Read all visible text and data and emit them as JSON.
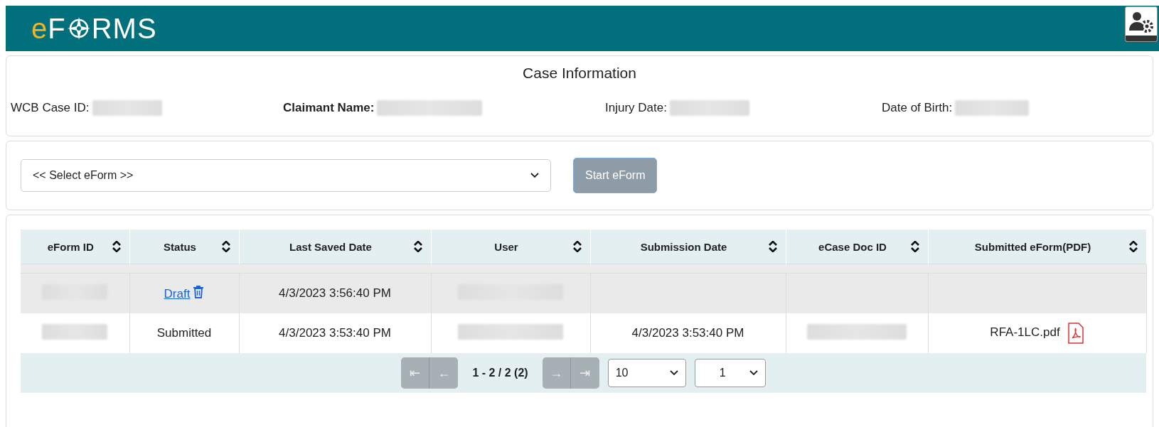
{
  "header": {
    "logo_prefix": "e",
    "logo_rest_1": "F",
    "logo_rest_2": "RMS"
  },
  "case_information": {
    "title": "Case Information",
    "fields": [
      {
        "label": "WCB Case ID:",
        "bold": false
      },
      {
        "label": "Claimant Name:",
        "bold": true
      },
      {
        "label": "Injury Date:",
        "bold": false
      },
      {
        "label": "Date of Birth:",
        "bold": false
      }
    ]
  },
  "eform_picker": {
    "select": {
      "value": "<< Select eForm >>"
    },
    "start_button": {
      "label": "Start eForm",
      "disabled": true
    }
  },
  "table": {
    "columns": [
      "eForm ID",
      "Status",
      "Last Saved Date",
      "User",
      "Submission Date",
      "eCase Doc ID",
      "Submitted eForm(PDF)"
    ],
    "rows": [
      {
        "selected": true,
        "cells": [
          {
            "kind": "redacted"
          },
          {
            "kind": "link",
            "text": "Draft"
          },
          {
            "kind": "text",
            "text": "4/3/2023 3:56:40 PM"
          },
          {
            "kind": "redacted"
          },
          {
            "kind": "empty"
          },
          {
            "kind": "empty"
          },
          {
            "kind": "empty"
          }
        ]
      },
      {
        "selected": false,
        "cells": [
          {
            "kind": "redacted"
          },
          {
            "kind": "text",
            "text": "Submitted"
          },
          {
            "kind": "text",
            "text": "4/3/2023 3:53:40 PM"
          },
          {
            "kind": "redacted"
          },
          {
            "kind": "text",
            "text": "4/3/2023 3:53:40 PM"
          },
          {
            "kind": "redacted"
          },
          {
            "kind": "file",
            "text": "RFA-1LC.pdf"
          }
        ]
      }
    ],
    "pager": {
      "first": "⇤",
      "prev": "←",
      "summary": "1 - 2 / 2 (2)",
      "next": "→",
      "last": "⇥",
      "page_size": "10",
      "page": "1"
    }
  }
}
